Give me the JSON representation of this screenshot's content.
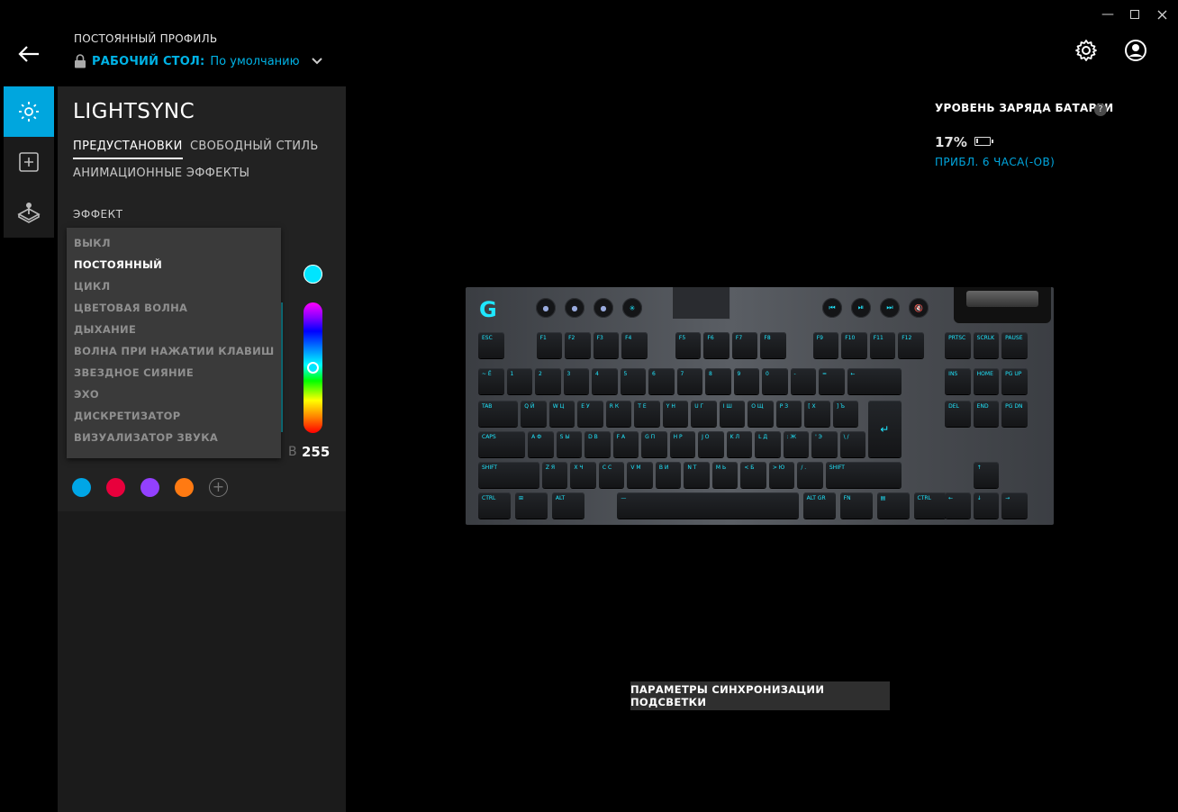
{
  "header": {
    "profile_label": "ПОСТОЯННЫЙ ПРОФИЛЬ",
    "profile_name": "РАБОЧИЙ СТОЛ:",
    "profile_value": "По умолчанию"
  },
  "panel": {
    "title": "LIGHTSYNC",
    "tabs": [
      "ПРЕДУСТАНОВКИ",
      "СВОБОДНЫЙ СТИЛЬ",
      "АНИМАЦИОННЫЕ ЭФФЕКТЫ"
    ],
    "effect_label": "ЭФФЕКТ",
    "effects": [
      "ВЫКЛ",
      "ПОСТОЯННЫЙ",
      "ЦИКЛ",
      "ЦВЕТОВАЯ ВОЛНА",
      "ДЫХАНИЕ",
      "ВОЛНА ПРИ НАЖАТИИ КЛАВИШ",
      "ЗВЕЗДНОЕ СИЯНИЕ",
      "ЭХО",
      "ДИСКРЕТИЗАТОР",
      "ВИЗУАЛИЗАТОР ЗВУКА"
    ],
    "selected_effect": "ПОСТОЯННЫЙ",
    "brightness_label": "В",
    "brightness_value": "255",
    "current_color": "#00e5ff",
    "swatches": [
      "#00a6e6",
      "#e8003c",
      "#9340ff",
      "#ff7a12"
    ]
  },
  "battery": {
    "title": "УРОВЕНЬ ЗАРЯДА БАТАРЕИ",
    "help": "?",
    "percent": "17%",
    "level": 0.17,
    "time": "ПРИБЛ. 6 ЧАСА(-ОВ)"
  },
  "keyboard": {
    "fn_row": [
      "ESC",
      "F1",
      "F2",
      "F3",
      "F4",
      "F5",
      "F6",
      "F7",
      "F8",
      "F9",
      "F10",
      "F11",
      "F12",
      "PRTSC",
      "SCRLK",
      "PAUSE"
    ],
    "num_row": [
      "~ Ё",
      "1",
      "2",
      "3",
      "4",
      "5",
      "6",
      "7",
      "8",
      "9",
      "0",
      "-",
      "=",
      "←",
      "INS",
      "HOME",
      "PG UP"
    ],
    "q_row": [
      "TAB",
      "Q Й",
      "W Ц",
      "E У",
      "R К",
      "T Е",
      "Y Н",
      "U Г",
      "I Ш",
      "O Щ",
      "P З",
      "[ Х",
      "] Ъ",
      "DEL",
      "END",
      "PG DN"
    ],
    "a_row": [
      "CAPS",
      "A Ф",
      "S Ы",
      "D В",
      "F А",
      "G П",
      "H Р",
      "J О",
      "K Л",
      "L Д",
      ": Ж",
      "' Э",
      "\\ /"
    ],
    "z_row": [
      "SHIFT",
      "Z Я",
      "X Ч",
      "C С",
      "V М",
      "B И",
      "N Т",
      "M Ь",
      "< Б",
      "> Ю",
      "/ .",
      "SHIFT",
      "↑"
    ],
    "bottom_row": [
      "CTRL",
      "⊞",
      "ALT",
      "—",
      "ALT GR",
      "FN",
      "▤",
      "CTRL",
      "←",
      "↓",
      "→"
    ],
    "enter": "↵"
  },
  "sync_button": "ПАРАМЕТРЫ СИНХРОНИЗАЦИИ ПОДСВЕТКИ"
}
